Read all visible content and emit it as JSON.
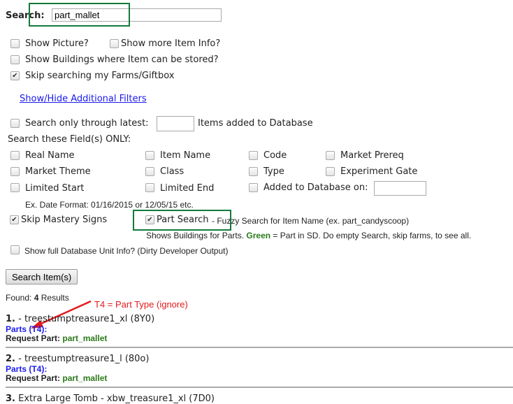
{
  "search": {
    "label": "Search:",
    "value": "part_mallet"
  },
  "options": {
    "show_picture": {
      "label": "Show Picture?",
      "checked": false
    },
    "show_more_info": {
      "label": "Show more Item Info?",
      "checked": false
    },
    "show_buildings": {
      "label": "Show Buildings where Item can be stored?",
      "checked": false
    },
    "skip_farms": {
      "label": "Skip searching my Farms/Giftbox",
      "checked": true
    }
  },
  "filters_link": "Show/Hide Additional Filters",
  "latest": {
    "label_before": "Search only through latest:",
    "label_after": "Items added to Database",
    "value": "",
    "checked": false
  },
  "fields_heading": "Search these Field(s) ONLY:",
  "fields": [
    "Real Name",
    "Item Name",
    "Code",
    "Market Prereq",
    "Market Theme",
    "Class",
    "Type",
    "Experiment Gate",
    "Limited Start",
    "Limited End",
    "Added to Database on:"
  ],
  "date_hint": "Ex. Date Format: 01/16/2015 or 12/05/15 etc.",
  "skip_mastery": {
    "label": "Skip Mastery Signs",
    "checked": true
  },
  "part_search": {
    "label": "Part Search",
    "desc": " - Fuzzy Search for Item Name (ex. part_candyscoop)",
    "checked": true,
    "note_1": "Shows Buildings for Parts. ",
    "note_green": "Green",
    "note_2": " = Part in SD. Do empty Search, skip farms, to see all."
  },
  "dev_output": {
    "label": "Show full Database Unit Info? (Dirty Developer Output)",
    "checked": false
  },
  "search_button": "Search Item(s)",
  "found": {
    "prefix": "Found: ",
    "count": "4",
    "suffix": " Results"
  },
  "annotation": "T4 = Part Type (ignore)",
  "results": [
    {
      "num": "1.",
      "name": " - treestumptreasure1_xl (8Y0)",
      "parts": "Parts (T4):",
      "req_label": "Request Part: ",
      "req_value": "part_mallet"
    },
    {
      "num": "2.",
      "name": " - treestumptreasure1_l (80o)",
      "parts": "Parts (T4):",
      "req_label": "Request Part: ",
      "req_value": "part_mallet"
    },
    {
      "num": "3.",
      "name": " Extra Large Tomb - xbw_treasure1_xl (7D0)"
    }
  ],
  "colors": {
    "highlight_box": "#137a3c",
    "link": "#1a1aee",
    "green": "#2a7a1a",
    "annotation": "#e21b1b"
  }
}
